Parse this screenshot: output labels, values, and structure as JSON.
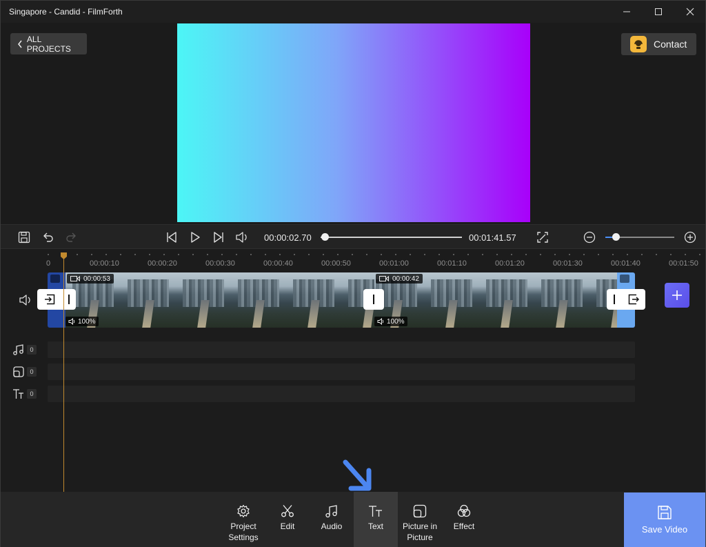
{
  "window": {
    "title": "Singapore - Candid - FilmForth"
  },
  "header": {
    "back_label": "ALL PROJECTS",
    "contact_label": "Contact"
  },
  "player": {
    "current_time": "00:00:02.70",
    "total_time": "00:01:41.57",
    "playback_progress": 0.027,
    "zoom_level": 0.15
  },
  "timeline": {
    "ruler": [
      "0",
      "00:00:10",
      "00:00:20",
      "00:00:30",
      "00:00:40",
      "00:00:50",
      "00:01:00",
      "00:01:10",
      "00:01:20",
      "00:01:30",
      "00:01:40",
      "00:01:50"
    ],
    "clips": [
      {
        "duration": "00:00:53",
        "volume": "100%"
      },
      {
        "duration": "00:00:42",
        "volume": "100%"
      }
    ],
    "tracks": [
      {
        "icon": "music-note-icon",
        "count": "0"
      },
      {
        "icon": "picture-in-picture-icon",
        "count": "0"
      },
      {
        "icon": "text-icon",
        "count": "0"
      }
    ]
  },
  "toolbar": {
    "tools": [
      {
        "label_line1": "Project",
        "label_line2": "Settings",
        "icon": "gear-icon"
      },
      {
        "label_line1": "Edit",
        "label_line2": "",
        "icon": "scissors-icon"
      },
      {
        "label_line1": "Audio",
        "label_line2": "",
        "icon": "music-note-icon"
      },
      {
        "label_line1": "Text",
        "label_line2": "",
        "icon": "text-icon"
      },
      {
        "label_line1": "Picture in",
        "label_line2": "Picture",
        "icon": "picture-in-picture-icon"
      },
      {
        "label_line1": "Effect",
        "label_line2": "",
        "icon": "effect-icon"
      }
    ],
    "save_label": "Save Video"
  },
  "colors": {
    "accent": "#6b92f2",
    "playhead": "#c28a2e",
    "add_button": "#5f5cf0",
    "arrow": "#4c86f0"
  }
}
